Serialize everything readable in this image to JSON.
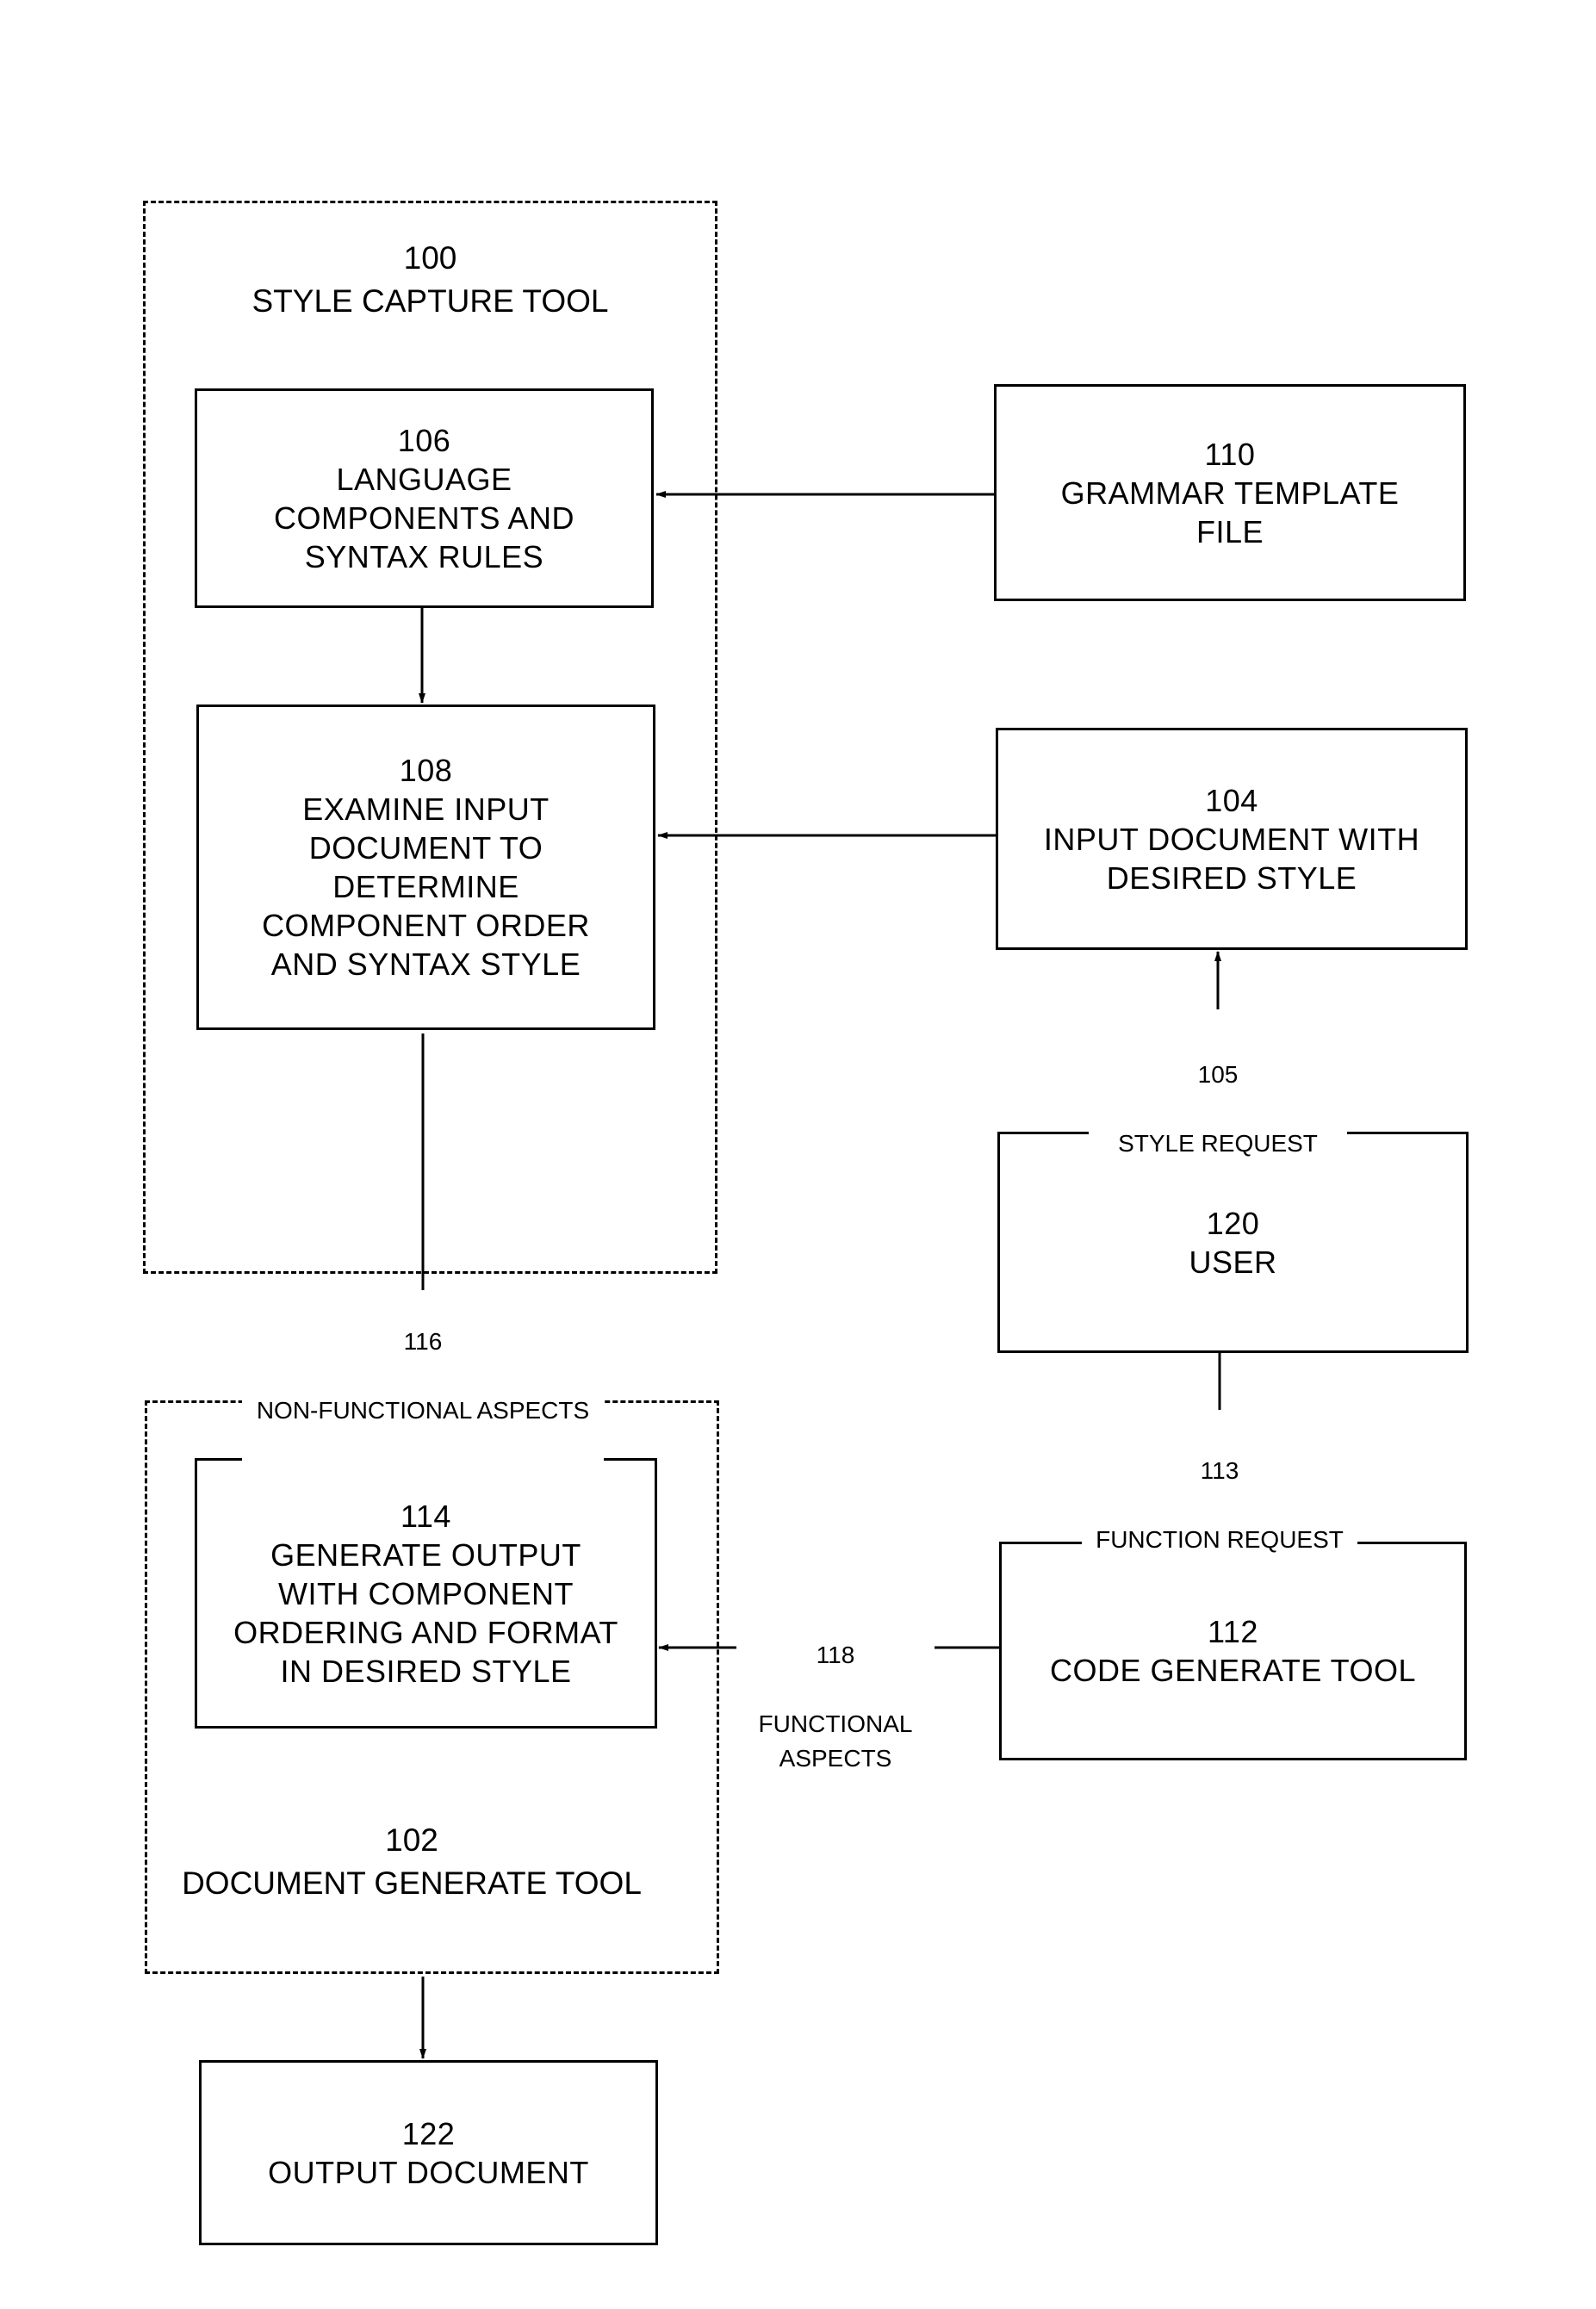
{
  "figure": {
    "groups": [
      {
        "id": "g100",
        "number": "100",
        "label": "STYLE CAPTURE TOOL"
      },
      {
        "id": "g102",
        "number": "102",
        "label": "DOCUMENT GENERATE TOOL"
      }
    ],
    "nodes": [
      {
        "id": "n106",
        "number": "106",
        "label": "LANGUAGE\nCOMPONENTS AND\nSYNTAX RULES"
      },
      {
        "id": "n108",
        "number": "108",
        "label": "EXAMINE INPUT\nDOCUMENT TO\nDETERMINE\nCOMPONENT ORDER\nAND SYNTAX STYLE"
      },
      {
        "id": "n110",
        "number": "110",
        "label": "GRAMMAR TEMPLATE\nFILE"
      },
      {
        "id": "n104",
        "number": "104",
        "label": "INPUT DOCUMENT WITH\nDESIRED STYLE"
      },
      {
        "id": "n120",
        "number": "120",
        "label": "USER"
      },
      {
        "id": "n112",
        "number": "112",
        "label": "CODE GENERATE TOOL"
      },
      {
        "id": "n114",
        "number": "114",
        "label": "GENERATE OUTPUT\nWITH COMPONENT\nORDERING AND FORMAT\nIN DESIRED STYLE"
      },
      {
        "id": "n122",
        "number": "122",
        "label": "OUTPUT DOCUMENT"
      }
    ],
    "edges": [
      {
        "id": "e110_106",
        "from": "110",
        "to": "106",
        "number": "",
        "label": ""
      },
      {
        "id": "e106_108",
        "from": "106",
        "to": "108",
        "number": "",
        "label": ""
      },
      {
        "id": "e104_108",
        "from": "104",
        "to": "108",
        "number": "",
        "label": ""
      },
      {
        "id": "e120_104",
        "from": "120",
        "to": "104",
        "number": "105",
        "label": "STYLE REQUEST"
      },
      {
        "id": "e108_114",
        "from": "108",
        "to": "114",
        "number": "116",
        "label": "NON-FUNCTIONAL ASPECTS"
      },
      {
        "id": "e120_112",
        "from": "120",
        "to": "112",
        "number": "113",
        "label": "FUNCTION REQUEST"
      },
      {
        "id": "e112_114",
        "from": "112",
        "to": "114",
        "number": "118",
        "label": "FUNCTIONAL\nASPECTS"
      },
      {
        "id": "e102_122",
        "from": "102",
        "to": "122",
        "number": "",
        "label": ""
      }
    ]
  }
}
